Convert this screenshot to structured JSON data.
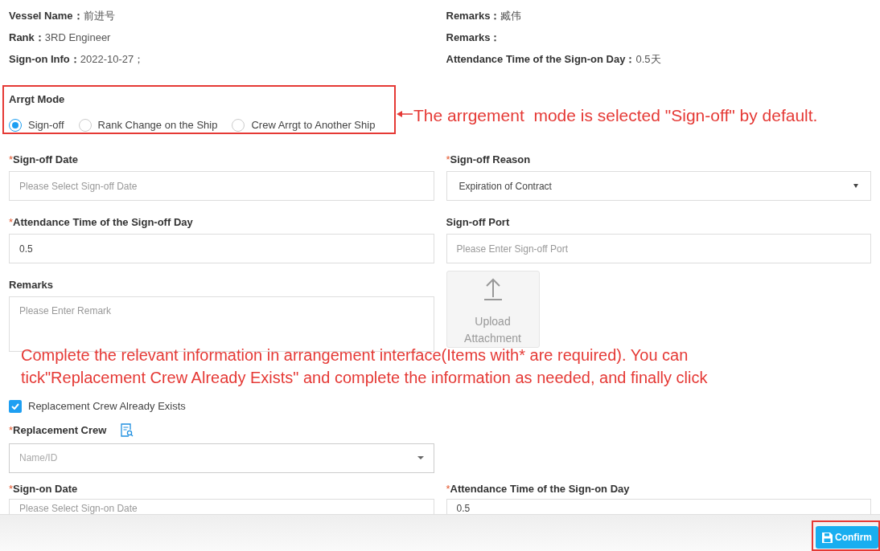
{
  "info": {
    "left": [
      {
        "label": "Vessel Name：",
        "value": "前进号"
      },
      {
        "label": "Rank：",
        "value": "3RD Engineer"
      },
      {
        "label": "Sign-on Info：",
        "value": "2022-10-27；"
      }
    ],
    "right": [
      {
        "label": "Remarks：",
        "value": "臧伟"
      },
      {
        "label": "Remarks："
      },
      {
        "label": "Attendance Time of the Sign-on Day：",
        "value": "0.5天"
      }
    ]
  },
  "arrgt_mode": {
    "label": "Arrgt Mode",
    "options": [
      {
        "label": "Sign-off",
        "selected": true
      },
      {
        "label": "Rank Change on the Ship",
        "selected": false
      },
      {
        "label": "Crew Arrgt to Another Ship",
        "selected": false
      }
    ]
  },
  "field_rows": [
    [
      {
        "kind": "input",
        "label": "Sign-off Date",
        "marker": "*",
        "placeholder": "Please Select Sign-off Date"
      },
      {
        "kind": "select",
        "label": "Sign-off Reason",
        "marker": "*",
        "value": "Expiration of Contract"
      }
    ],
    [
      {
        "kind": "input",
        "label": "Attendance Time of the Sign-off Day",
        "marker": "*",
        "value": "0.5"
      },
      {
        "kind": "input",
        "label": "Sign-off Port",
        "placeholder": "Please Enter Sign-off Port"
      }
    ],
    [
      {
        "kind": "textarea",
        "label": "Remarks",
        "placeholder": "Please Enter Remark"
      },
      {
        "kind": "upload",
        "label": "Upload Attachment"
      }
    ]
  ],
  "replacement_checkbox": {
    "label": "Replacement Crew Already Exists",
    "checked": true
  },
  "replacement_crew": {
    "label": "Replacement Crew",
    "marker": "*",
    "placeholder": "Name/ID"
  },
  "bottom_row": [
    {
      "kind": "input",
      "label": "Sign-on Date",
      "marker": "*",
      "placeholder": "Please Select Sign-on Date"
    },
    {
      "kind": "input",
      "label": "Attendance Time of the Sign-on Day",
      "marker": "*",
      "value": "0.5"
    }
  ],
  "footer": {
    "confirm": "Confirm"
  },
  "annotations": {
    "mode_note": "The arrgement  mode is selected \"Sign-off\" by default.",
    "form_note": [
      "Complete the relevant information in arrangement interface(Items with* are required). You can",
      "tick\"Replacement Crew Already Exists\" and complete the information as needed, and finally click"
    ]
  }
}
